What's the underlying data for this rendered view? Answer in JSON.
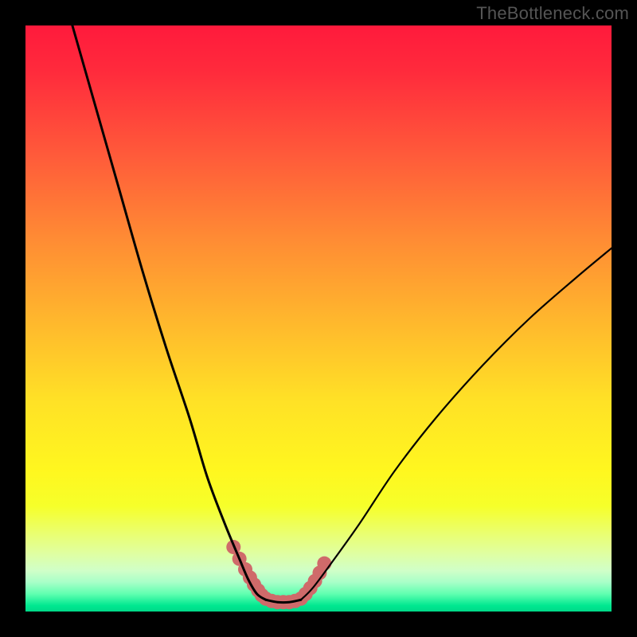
{
  "watermark": {
    "text": "TheBottleneck.com"
  },
  "colors": {
    "curve": "#000000",
    "marker": "#cf6a6a",
    "background_top": "#ff1a3c",
    "background_bottom": "#00d888",
    "frame": "#000000"
  },
  "chart_data": {
    "type": "line",
    "title": "",
    "xlabel": "",
    "ylabel": "",
    "xlim": [
      0,
      100
    ],
    "ylim": [
      0,
      100
    ],
    "grid": false,
    "note": "Axes implied by gradient: y runs 100 (top, red / high bottleneck) to 0 (bottom, green / optimal). No tick labels are rendered in the image; values below are visual estimates from curve geometry.",
    "series": [
      {
        "name": "left-branch",
        "x": [
          8,
          12,
          16,
          20,
          24,
          28,
          31,
          34,
          36.5,
          38,
          39.5,
          41
        ],
        "y": [
          100,
          86,
          72,
          58,
          45,
          33,
          23,
          15,
          9,
          5.5,
          3,
          2
        ]
      },
      {
        "name": "valley-floor",
        "x": [
          41,
          43,
          45,
          47
        ],
        "y": [
          2,
          1.6,
          1.6,
          2
        ]
      },
      {
        "name": "right-branch",
        "x": [
          47,
          49,
          52,
          57,
          63,
          70,
          78,
          86,
          94,
          100
        ],
        "y": [
          2,
          4,
          8,
          15,
          24,
          33,
          42,
          50,
          57,
          62
        ]
      }
    ],
    "markers": {
      "name": "highlighted-segments",
      "color": "#cf6a6a",
      "note": "Thick salmon dots/segments near the valley on both branches and along the floor.",
      "points_x": [
        35.5,
        36.5,
        37.5,
        38.3,
        39.0,
        39.7,
        40.3,
        41.0,
        42.0,
        43.0,
        44.0,
        45.0,
        46.0,
        47.0,
        47.8,
        48.6,
        49.4,
        50.2,
        51.0
      ],
      "points_y": [
        11.0,
        9.0,
        7.2,
        5.8,
        4.6,
        3.6,
        2.8,
        2.2,
        1.8,
        1.6,
        1.6,
        1.6,
        1.8,
        2.2,
        3.0,
        4.0,
        5.2,
        6.6,
        8.2
      ]
    }
  }
}
